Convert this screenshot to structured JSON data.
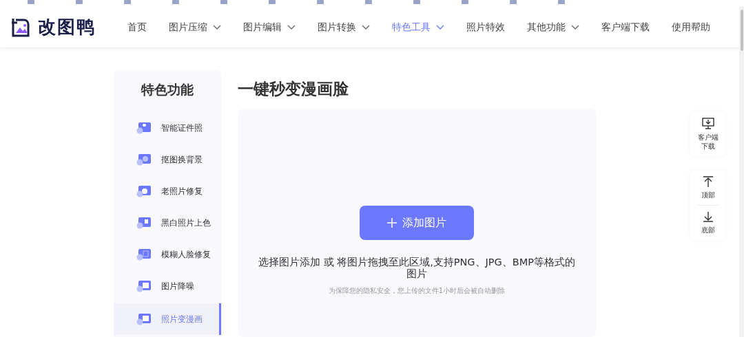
{
  "nav": {
    "logo": "改图鸭",
    "items": [
      {
        "label": "首页",
        "dropdown": false,
        "selected": false
      },
      {
        "label": "图片压缩",
        "dropdown": true,
        "selected": false
      },
      {
        "label": "图片编辑",
        "dropdown": true,
        "selected": false
      },
      {
        "label": "图片转换",
        "dropdown": true,
        "selected": false
      },
      {
        "label": "特色工具",
        "dropdown": true,
        "selected": true
      },
      {
        "label": "照片特效",
        "dropdown": false,
        "selected": false
      },
      {
        "label": "其他功能",
        "dropdown": true,
        "selected": false
      },
      {
        "label": "客户端下载",
        "dropdown": false,
        "selected": false
      },
      {
        "label": "使用帮助",
        "dropdown": false,
        "selected": false
      }
    ]
  },
  "sidebar": {
    "title": "特色功能",
    "items": [
      {
        "label": "智能证件照",
        "selected": false
      },
      {
        "label": "抠图换背景",
        "selected": false
      },
      {
        "label": "老照片修复",
        "selected": false
      },
      {
        "label": "黑白照片上色",
        "selected": false
      },
      {
        "label": "模糊人脸修复",
        "selected": false
      },
      {
        "label": "图片降噪",
        "selected": false
      },
      {
        "label": "照片变漫画",
        "selected": true
      }
    ]
  },
  "main": {
    "title": "一键秒变漫画脸",
    "upload_button": "添加图片",
    "hint": "选择图片添加 或 将图片拖拽至此区域,支持PNG、JPG、BMP等格式的图片",
    "privacy_note": "为保障您的隐私安全，您上传的文件1小时后会被自动删除"
  },
  "float_panel": {
    "download": "客户端下载",
    "top": "顶部",
    "bottom": "底部"
  }
}
